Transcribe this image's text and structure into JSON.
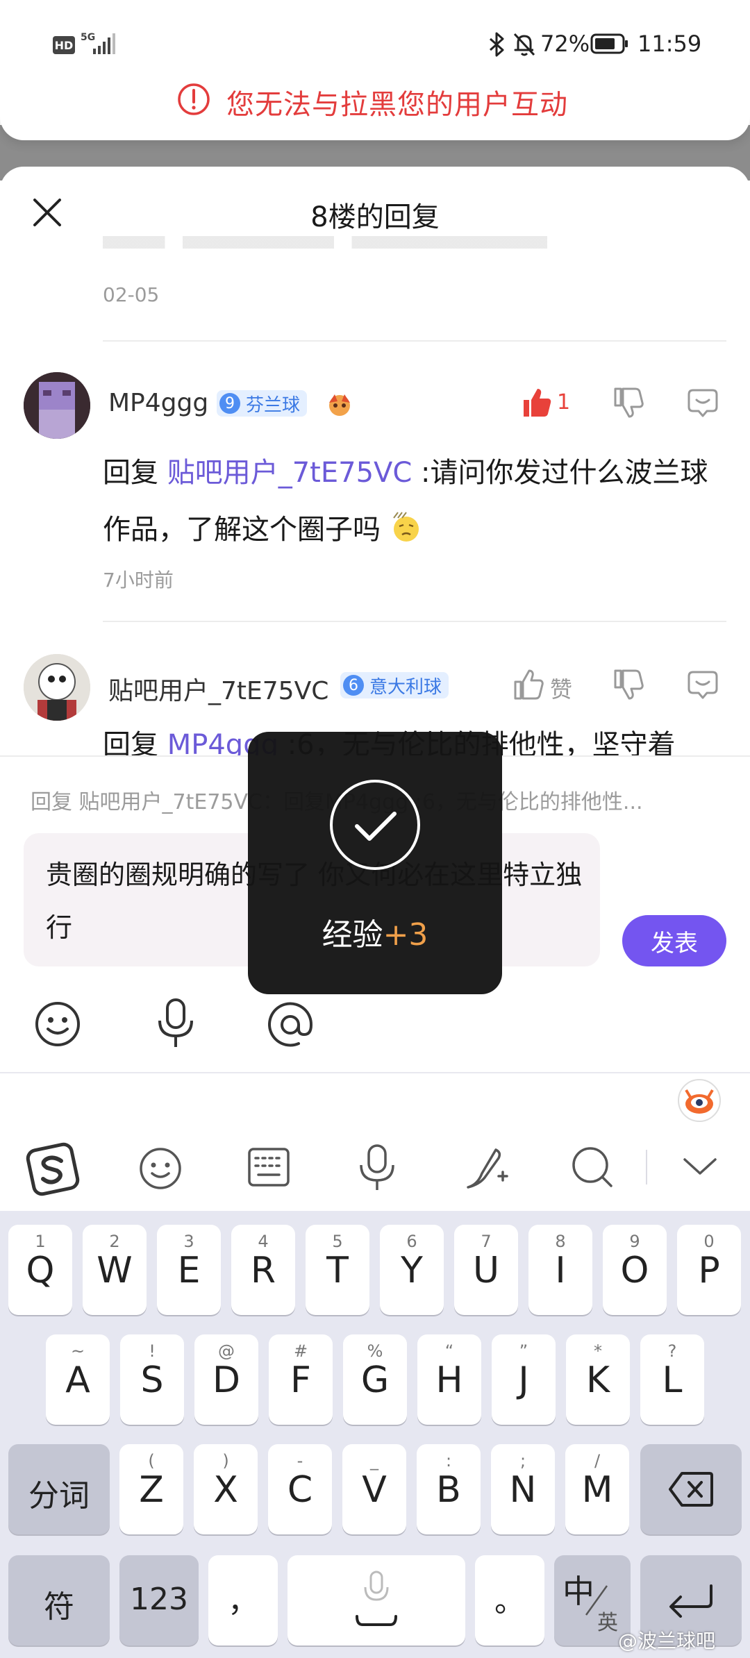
{
  "status_bar": {
    "hd": "HD",
    "network": "5G",
    "battery_percent": "72%",
    "time": "11:59"
  },
  "banner": {
    "warning": "您无法与拉黑您的用户互动"
  },
  "sheet": {
    "title": "8楼的回复",
    "prev_timestamp": "02-05"
  },
  "replies": [
    {
      "username": "MP4ggg",
      "level": "9",
      "level_name": "芬兰球",
      "like_count": "1",
      "reply_prefix": "回复 ",
      "mention": "贴吧用户_7tE75VC",
      "text": " :请问你发过什么波兰球作品，了解这个圈子吗",
      "timestamp": "7小时前"
    },
    {
      "username": "贴吧用户_7tE75VC",
      "level": "6",
      "level_name": "意大利球",
      "like_label": "赞",
      "reply_prefix": "回复 ",
      "mention": "MP4ggg",
      "text": " :6，无与伦比的排他性，坚守着"
    }
  ],
  "composer": {
    "quote": "回复 贴吧用户_7tE75VC：回复MP4ggg :6，无与伦比的排他性...",
    "text": "贵圈的圈规明确的写了 你又何必在这里特立独行",
    "publish_label": "发表"
  },
  "toast": {
    "label": "经验",
    "points": "+3"
  },
  "keyboard": {
    "row1": [
      {
        "k": "Q",
        "s": "1"
      },
      {
        "k": "W",
        "s": "2"
      },
      {
        "k": "E",
        "s": "3"
      },
      {
        "k": "R",
        "s": "4"
      },
      {
        "k": "T",
        "s": "5"
      },
      {
        "k": "Y",
        "s": "6"
      },
      {
        "k": "U",
        "s": "7"
      },
      {
        "k": "I",
        "s": "8"
      },
      {
        "k": "O",
        "s": "9"
      },
      {
        "k": "P",
        "s": "0"
      }
    ],
    "row2": [
      {
        "k": "A",
        "s": "~"
      },
      {
        "k": "S",
        "s": "!"
      },
      {
        "k": "D",
        "s": "@"
      },
      {
        "k": "F",
        "s": "#"
      },
      {
        "k": "G",
        "s": "%"
      },
      {
        "k": "H",
        "s": "“"
      },
      {
        "k": "J",
        "s": "”"
      },
      {
        "k": "K",
        "s": "*"
      },
      {
        "k": "L",
        "s": "?"
      }
    ],
    "row3": [
      {
        "k": "Z",
        "s": "("
      },
      {
        "k": "X",
        "s": ")"
      },
      {
        "k": "C",
        "s": "-"
      },
      {
        "k": "V",
        "s": "_"
      },
      {
        "k": "B",
        "s": ":"
      },
      {
        "k": "N",
        "s": ";"
      },
      {
        "k": "M",
        "s": "/"
      }
    ],
    "fenci": "分词",
    "fu": "符",
    "num": "123",
    "comma": "，",
    "period": "。",
    "zh": "中",
    "en": "英"
  },
  "watermark": "@波兰球吧",
  "colors": {
    "accent": "#7455f0",
    "warning": "#e33c3c",
    "like_red": "#e8413a",
    "mention": "#6b5ad8"
  }
}
